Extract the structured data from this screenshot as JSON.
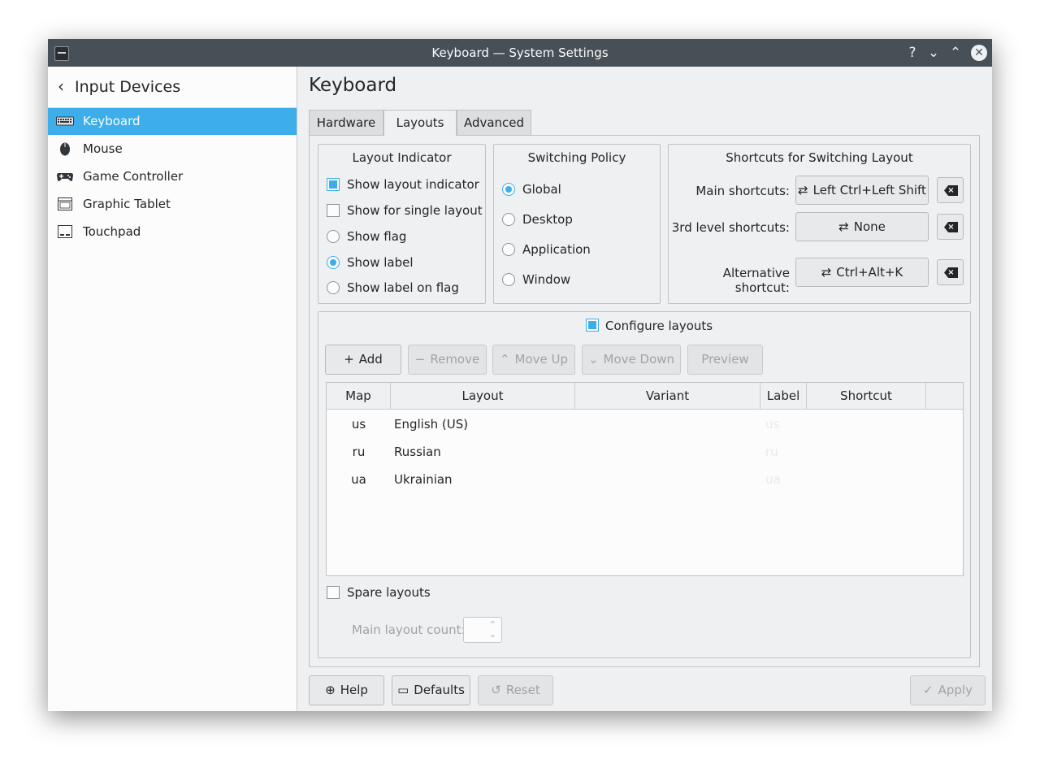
{
  "window": {
    "title": "Keyboard — System Settings"
  },
  "titlebar_buttons": {
    "help": "?",
    "minimize": "⌄",
    "maximize": "⌃",
    "close": "✕"
  },
  "sidebar": {
    "back_glyph": "‹",
    "header": "Input Devices",
    "items": [
      {
        "label": "Keyboard",
        "icon": "keyboard-icon",
        "selected": true
      },
      {
        "label": "Mouse",
        "icon": "mouse-icon"
      },
      {
        "label": "Game Controller",
        "icon": "gamepad-icon"
      },
      {
        "label": "Graphic Tablet",
        "icon": "tablet-icon"
      },
      {
        "label": "Touchpad",
        "icon": "touchpad-icon"
      }
    ]
  },
  "page_title": "Keyboard",
  "tabs": [
    {
      "label": "Hardware"
    },
    {
      "label": "Layouts",
      "active": true
    },
    {
      "label": "Advanced"
    }
  ],
  "layout_indicator": {
    "title": "Layout Indicator",
    "options": [
      {
        "label": "Show layout indicator",
        "type": "checkbox",
        "checked": true
      },
      {
        "label": "Show for single layout",
        "type": "checkbox",
        "checked": false
      },
      {
        "label": "Show flag",
        "type": "radio",
        "checked": false
      },
      {
        "label": "Show label",
        "type": "radio",
        "checked": true
      },
      {
        "label": "Show label on flag",
        "type": "radio",
        "checked": false
      }
    ]
  },
  "switching_policy": {
    "title": "Switching Policy",
    "options": [
      {
        "label": "Global",
        "checked": true
      },
      {
        "label": "Desktop",
        "checked": false
      },
      {
        "label": "Application",
        "checked": false
      },
      {
        "label": "Window",
        "checked": false
      }
    ]
  },
  "shortcuts": {
    "title": "Shortcuts for Switching Layout",
    "rows": [
      {
        "label": "Main shortcuts:",
        "value": "Left Ctrl+Left Shift"
      },
      {
        "label": "3rd level shortcuts:",
        "value": "None"
      },
      {
        "label": "Alternative shortcut:",
        "value": "Ctrl+Alt+K"
      }
    ],
    "clear_glyph": "×"
  },
  "configure": {
    "label": "Configure layouts",
    "checked": true,
    "buttons": [
      {
        "label": "Add",
        "glyph": "+",
        "disabled": false
      },
      {
        "label": "Remove",
        "glyph": "−",
        "disabled": true
      },
      {
        "label": "Move Up",
        "glyph": "⌃",
        "disabled": true
      },
      {
        "label": "Move Down",
        "glyph": "⌄",
        "disabled": true
      },
      {
        "label": "Preview",
        "glyph": "",
        "disabled": true
      }
    ],
    "columns": [
      "Map",
      "Layout",
      "Variant",
      "Label",
      "Shortcut"
    ],
    "rows": [
      {
        "map": "us",
        "layout": "English (US)",
        "variant": "",
        "label": "us",
        "shortcut": ""
      },
      {
        "map": "ru",
        "layout": "Russian",
        "variant": "",
        "label": "ru",
        "shortcut": ""
      },
      {
        "map": "ua",
        "layout": "Ukrainian",
        "variant": "",
        "label": "ua",
        "shortcut": ""
      }
    ]
  },
  "spare_layouts": {
    "label": "Spare layouts",
    "checked": false
  },
  "main_layout_count": {
    "label": "Main layout count:",
    "value": ""
  },
  "footer": {
    "help": "Help",
    "defaults": "Defaults",
    "reset": "Reset",
    "apply": "Apply",
    "apply_glyph": "✓",
    "reset_glyph": "↺"
  },
  "colors": {
    "accent": "#3daee9",
    "titlebar": "#475057",
    "window_bg": "#eff0f1"
  }
}
